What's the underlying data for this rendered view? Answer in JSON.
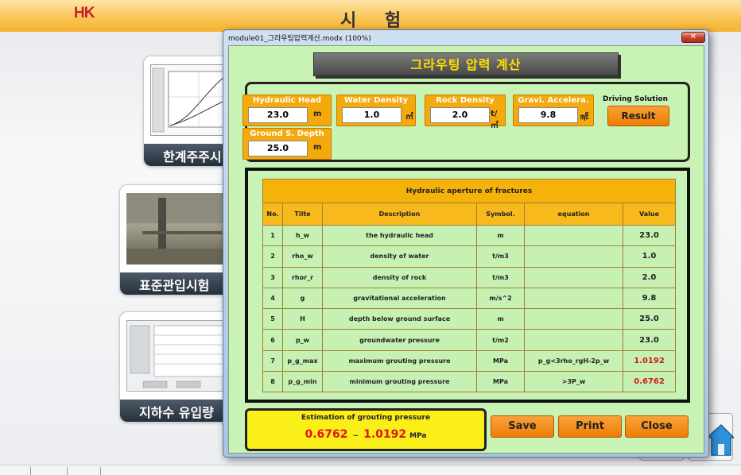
{
  "app": {
    "logo": "HK",
    "title": "시 험"
  },
  "background_cards": [
    {
      "label": "한계주주시"
    },
    {
      "label": "표준관입시험"
    },
    {
      "label": "지하수 유입량"
    }
  ],
  "dialog": {
    "window_title": "module01_그라우팅압력계산.modx (100%)",
    "close_glyph": "✕",
    "heading": "그라우팅 압력 계산",
    "inputs": {
      "hydraulic_head": {
        "label": "Hydraulic Head",
        "value": "23.0",
        "unit": "m"
      },
      "water_density": {
        "label": "Water Density",
        "value": "1.0",
        "unit": "㎥"
      },
      "rock_density": {
        "label": "Rock Density",
        "value": "2.0",
        "unit": "t/㎥"
      },
      "gravi_accel": {
        "label": "Gravi. Accelera.",
        "value": "9.8",
        "unit": "㎨"
      },
      "ground_depth": {
        "label": "Ground S. Depth",
        "value": "25.0",
        "unit": "m"
      }
    },
    "driving_solution_label": "Driving Solution",
    "result_button": "Result",
    "table": {
      "caption": "Hydraulic aperture of fractures",
      "columns": [
        "No.",
        "Tilte",
        "Description",
        "Symbol.",
        "equation",
        "Value"
      ],
      "rows": [
        {
          "no": "1",
          "title": "h_w",
          "description": "the hydraulic head",
          "symbol": "m",
          "equation": "",
          "value": "23.0"
        },
        {
          "no": "2",
          "title": "rho_w",
          "description": "density of water",
          "symbol": "t/m3",
          "equation": "",
          "value": "1.0"
        },
        {
          "no": "3",
          "title": "rhor_r",
          "description": "density of rock",
          "symbol": "t/m3",
          "equation": "",
          "value": "2.0"
        },
        {
          "no": "4",
          "title": "g",
          "description": "gravitational acceleration",
          "symbol": "m/s^2",
          "equation": "",
          "value": "9.8"
        },
        {
          "no": "5",
          "title": "H",
          "description": "depth below ground surface",
          "symbol": "m",
          "equation": "",
          "value": "25.0"
        },
        {
          "no": "6",
          "title": "p_w",
          "description": "groundwater pressure",
          "symbol": "t/m2",
          "equation": "",
          "value": "23.0"
        },
        {
          "no": "7",
          "title": "p_g_max",
          "description": "maximum grouting pressure",
          "symbol": "MPa",
          "equation": "p_g<3rho_rgH-2p_w",
          "value": "1.0192"
        },
        {
          "no": "8",
          "title": "p_g_min",
          "description": "minimum grouting pressure",
          "symbol": "MPa",
          "equation": ">3P_w",
          "value": "0.6762"
        }
      ]
    },
    "estimation": {
      "title": "Estimation of grouting pressure",
      "min": "0.6762",
      "separator": "~",
      "max": "1.0192",
      "unit": "MPa"
    },
    "buttons": {
      "save": "Save",
      "print": "Print",
      "close": "Close"
    }
  },
  "colors": {
    "dialog_body": "#c8f3b5",
    "accent_orange": "#f4a90d",
    "highlight_red": "#d21a1a",
    "title_yellow": "#ffe000"
  }
}
